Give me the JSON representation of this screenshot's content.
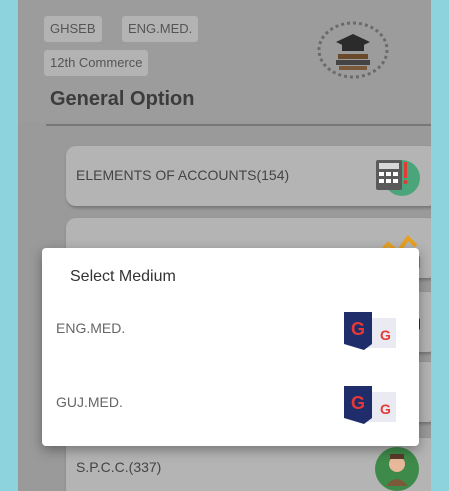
{
  "header": {
    "board": "GHSEB",
    "medium": "ENG.MED.",
    "standard": "12th Commerce",
    "title": "General Option"
  },
  "cards": [
    {
      "label": "ELEMENTS OF ACCOUNTS(154)",
      "icon": "calculator-icon"
    },
    {
      "label": "",
      "icon": "chart-icon"
    },
    {
      "label": "",
      "icon": "book-icon"
    },
    {
      "label": "",
      "icon": "red-book-icon"
    },
    {
      "label": "S.P.C.C.(337)",
      "icon": "teacher-icon"
    }
  ],
  "dialog": {
    "title": "Select Medium",
    "options": [
      {
        "label": "ENG.MED.",
        "icon": "google-translate-icon"
      },
      {
        "label": "GUJ.MED.",
        "icon": "google-translate-icon"
      }
    ]
  },
  "colors": {
    "background": "#8dd3dd",
    "dim_screen": "#9a9a9a",
    "dialog": "#ffffff",
    "accent_red": "#e53935",
    "accent_navy": "#1f2d6b"
  }
}
